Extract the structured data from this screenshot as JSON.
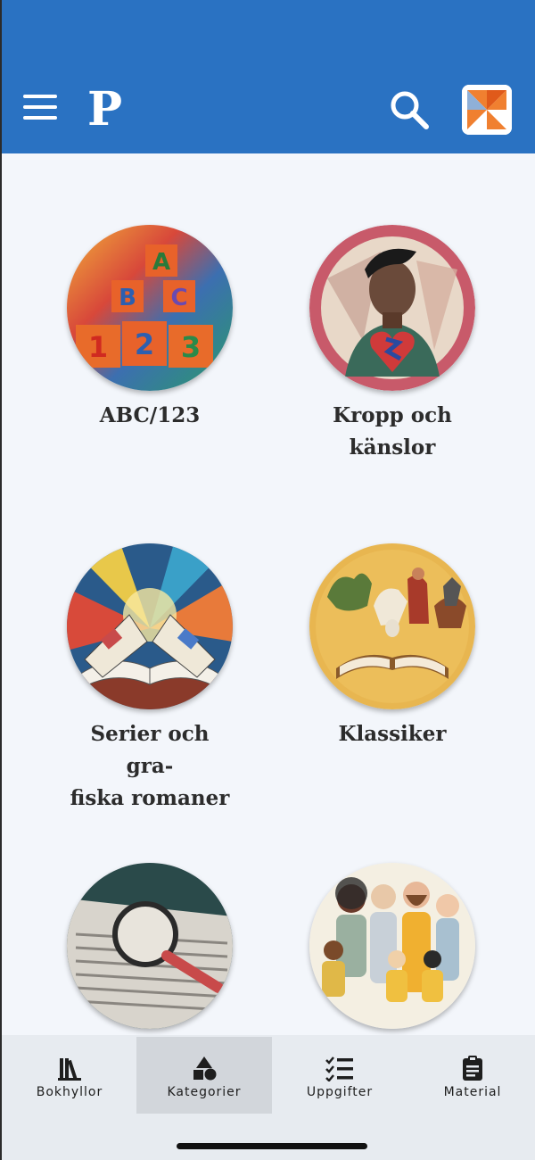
{
  "app": {
    "logo_letter": "P",
    "accent_color": "#2a72c2"
  },
  "header": {
    "menu_icon": "hamburger-menu-icon",
    "search_icon": "search-icon",
    "avatar_icon": "pinwheel-logo-icon"
  },
  "categories": [
    {
      "label": "ABC/123",
      "icon": "abc-blocks-image"
    },
    {
      "label": "Kropp och känslor",
      "icon": "body-heart-image"
    },
    {
      "label": "Serier och gra-fiska romaner",
      "label_line1": "Serier och gra-",
      "label_line2": "fiska romaner",
      "icon": "comic-book-image"
    },
    {
      "label": "Klassiker",
      "icon": "classics-book-image"
    },
    {
      "label": "",
      "icon": "magnifier-page-image"
    },
    {
      "label": "",
      "icon": "family-image"
    }
  ],
  "tabs": [
    {
      "label": "Bokhyllor",
      "icon": "bookshelf-icon",
      "active": false
    },
    {
      "label": "Kategorier",
      "icon": "shapes-icon",
      "active": true
    },
    {
      "label": "Uppgifter",
      "icon": "checklist-icon",
      "active": false
    },
    {
      "label": "Material",
      "icon": "clipboard-icon",
      "active": false
    }
  ]
}
